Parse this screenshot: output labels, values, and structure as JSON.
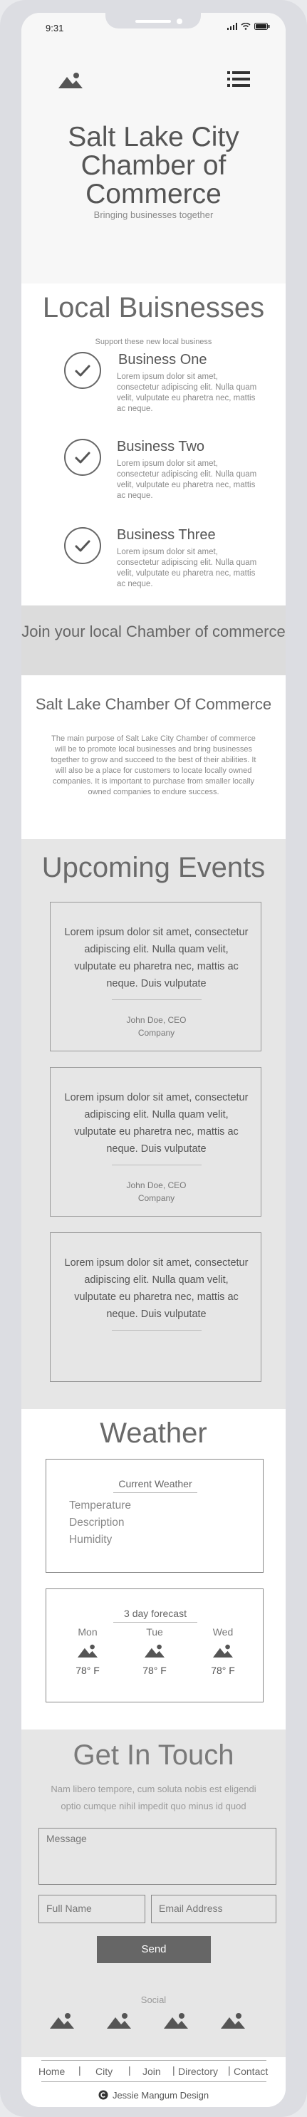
{
  "status_bar": {
    "time": "9:31"
  },
  "header": {
    "title": "Salt Lake City Chamber of Commerce",
    "subtitle": "Bringing businesses together"
  },
  "local_businesses": {
    "title": "Local Buisnesses",
    "subtitle": "Support these new local business",
    "items": [
      {
        "name": "Business One",
        "desc": "Lorem ipsum dolor sit amet, consectetur adipiscing elit. Nulla quam velit, vulputate eu pharetra nec, mattis ac neque."
      },
      {
        "name": "Business Two",
        "desc": "Lorem ipsum dolor sit amet, consectetur adipiscing elit. Nulla quam velit, vulputate eu pharetra nec, mattis ac neque."
      },
      {
        "name": "Business Three",
        "desc": "Lorem ipsum dolor sit amet, consectetur adipiscing elit. Nulla quam velit, vulputate eu pharetra nec, mattis ac neque."
      }
    ]
  },
  "join_banner": {
    "text": "Join your local Chamber of commerce"
  },
  "chamber": {
    "title": "Salt Lake Chamber Of Commerce",
    "body": "The main purpose of Salt Lake City Chamber of commerce will be to promote local businesses and bring businesses together to grow and succeed to the best of their abilities. It will also be a place for customers to locate locally owned companies. It is important to purchase from smaller locally owned companies to endure success."
  },
  "events": {
    "title": "Upcoming Events",
    "cards": [
      {
        "text": "Lorem ipsum dolor sit amet, consectetur adipiscing elit. Nulla quam velit, vulputate eu pharetra nec, mattis ac neque. Duis vulputate",
        "author": "John Doe, CEO",
        "company": "Company"
      },
      {
        "text": "Lorem ipsum dolor sit amet, consectetur adipiscing elit. Nulla quam velit, vulputate eu pharetra nec, mattis ac neque. Duis vulputate",
        "author": "John Doe, CEO",
        "company": "Company"
      },
      {
        "text": "Lorem ipsum dolor sit amet, consectetur adipiscing elit. Nulla quam velit, vulputate eu pharetra nec, mattis ac neque. Duis vulputate",
        "author": "",
        "company": ""
      }
    ]
  },
  "weather": {
    "title": "Weather",
    "current": {
      "caption": "Current Weather",
      "lines": [
        "Temperature",
        "Description",
        "Humidity"
      ]
    },
    "forecast": {
      "caption": "3 day forecast",
      "days": [
        {
          "day": "Mon",
          "temp": "78° F"
        },
        {
          "day": "Tue",
          "temp": "78° F"
        },
        {
          "day": "Wed",
          "temp": "78° F"
        }
      ]
    }
  },
  "contact": {
    "title": "Get In Touch",
    "subtitle": "Nam libero tempore, cum soluta nobis est eligendi optio cumque nihil impedit quo minus id quod",
    "message_placeholder": "Message",
    "name_placeholder": "Full Name",
    "email_placeholder": "Email Address",
    "send_label": "Send",
    "social_label": "Social"
  },
  "footer": {
    "nav": [
      "Home",
      "City",
      "Join",
      "Directory",
      "Contact"
    ],
    "copyright": "Jessie Mangum Design"
  },
  "colors": {
    "band_gray": "#dcdcdc",
    "section_gray": "#e6e6e6",
    "button": "#666666"
  },
  "icons": [
    "image-icon",
    "hamburger-menu-icon",
    "check-circle-icon",
    "copyright-icon"
  ]
}
